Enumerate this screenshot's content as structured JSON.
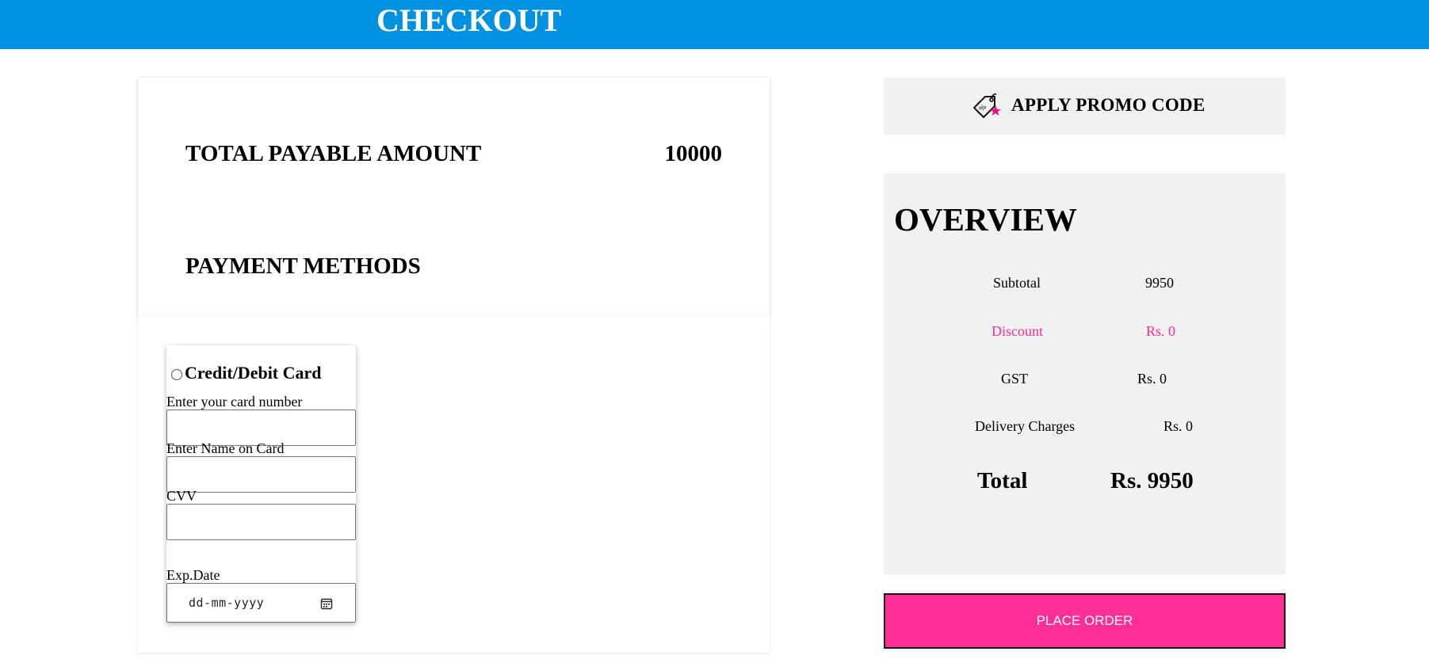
{
  "header": {
    "title": "CHECKOUT"
  },
  "payment": {
    "total_label": "TOTAL PAYABLE AMOUNT",
    "total_value": "10000",
    "methods_title": "PAYMENT METHODS",
    "card_option_label": "Credit/Debit Card",
    "card_number_label": "Enter your card number",
    "card_name_label": "Enter Name on Card",
    "cvv_label": "CVV",
    "exp_label": "Exp.Date",
    "exp_placeholder": "dd-mm-yyyy"
  },
  "promo": {
    "label": "APPLY PROMO CODE",
    "icon": "promo-tag-icon"
  },
  "overview": {
    "title": "OVERVIEW",
    "subtotal_label": "Subtotal",
    "subtotal_value": "9950",
    "discount_label": "Discount",
    "discount_value": "Rs. 0",
    "gst_label": "GST",
    "gst_value": "Rs. 0",
    "delivery_label": "Delivery Charges",
    "delivery_value": "Rs. 0",
    "total_label": "Total",
    "total_value": "Rs. 9950"
  },
  "place_order": {
    "label": "PLACE ORDER"
  },
  "colors": {
    "header": "#0091e0",
    "accent_pink": "#ff2d96",
    "discount_text": "#ff2d8c",
    "panel_gray": "#f1f1f1"
  }
}
